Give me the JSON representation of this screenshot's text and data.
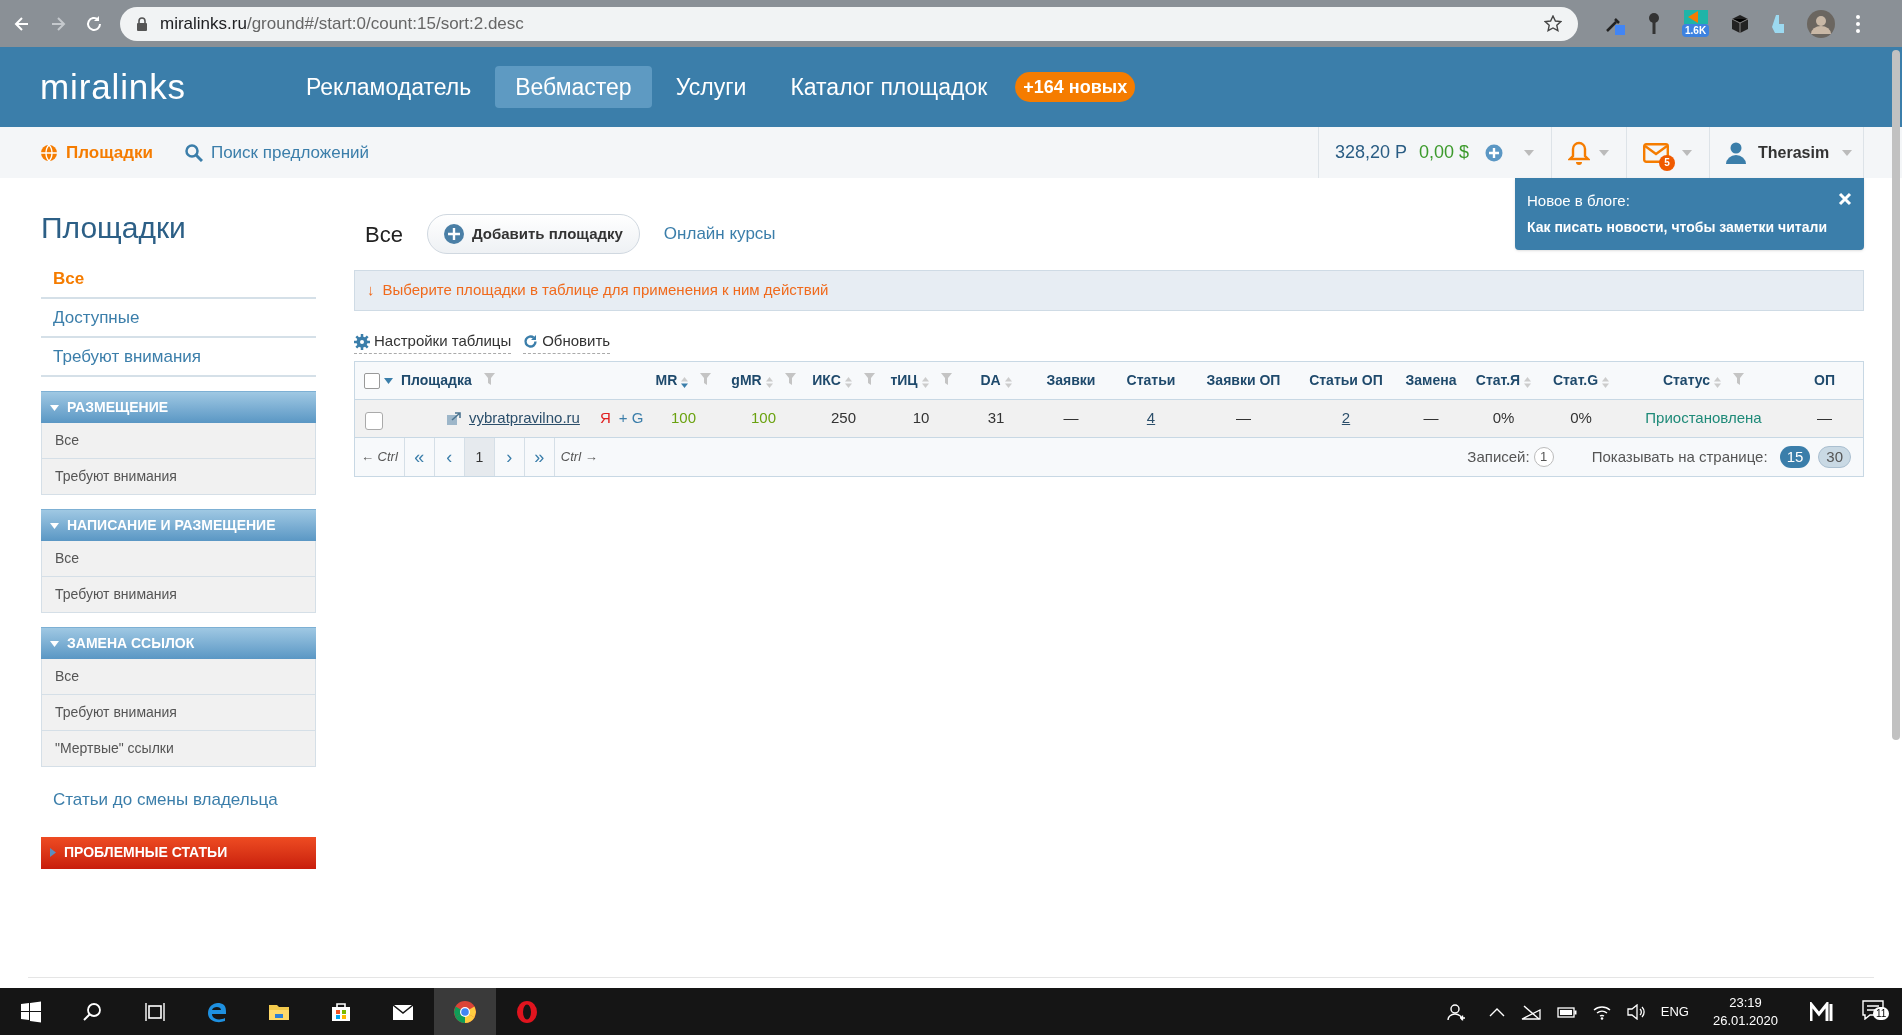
{
  "browser": {
    "url_host": "miralinks.ru",
    "url_path": "/ground#/start:0/count:15/sort:2.desc",
    "extension_badge": "1.6K"
  },
  "header": {
    "logo": "miralinks",
    "nav": [
      {
        "label": "Рекламодатель",
        "selected": false
      },
      {
        "label": "Вебмастер",
        "selected": true
      },
      {
        "label": "Услуги",
        "selected": false
      },
      {
        "label": "Каталог площадок",
        "selected": false
      }
    ],
    "catalog_badge": "+164 новых"
  },
  "subnav": {
    "items": [
      {
        "label": "Площадки",
        "selected": true,
        "kind": "globe"
      },
      {
        "label": "Поиск предложений",
        "selected": false,
        "kind": "search"
      }
    ],
    "balance_rub": "328,20 Р",
    "balance_usd": "0,00 $",
    "messages_count": "5",
    "user": "Therasim"
  },
  "blog_popup": {
    "title": "Новое в блоге:",
    "link": "Как писать новости, чтобы заметки читали"
  },
  "sidebar": {
    "title": "Площадки",
    "items": [
      {
        "label": "Все",
        "selected": true
      },
      {
        "label": "Доступные",
        "selected": false
      },
      {
        "label": "Требуют внимания",
        "selected": false
      }
    ],
    "sections": [
      {
        "title": "РАЗМЕЩЕНИЕ",
        "items": [
          "Все",
          "Требуют внимания"
        ]
      },
      {
        "title": "НАПИСАНИЕ И РАЗМЕЩЕНИЕ",
        "items": [
          "Все",
          "Требуют внимания"
        ]
      },
      {
        "title": "ЗАМЕНА ССЫЛОК",
        "items": [
          "Все",
          "Требуют внимания",
          "\"Мертвые\" ссылки"
        ]
      }
    ],
    "owner_link": "Статьи до смены владельца",
    "problem_button": "ПРОБЛЕМНЫЕ СТАТЬИ"
  },
  "main": {
    "tab": "Все",
    "add_button": "Добавить площадку",
    "courses_link": "Онлайн курсы",
    "hint": "Выберите площадки в таблице для применения к ним действий",
    "hint_arrow": "↓",
    "toolbar": [
      "Настройки таблицы",
      "Обновить"
    ],
    "table": {
      "select_all_checked": false,
      "columns": [
        {
          "label": "Площадка",
          "sortable": false,
          "filter": true
        },
        {
          "label": "MR",
          "sortable": true,
          "sorted_desc": true,
          "filter": true
        },
        {
          "label": "gMR",
          "sortable": true,
          "sorted_desc": false,
          "filter": true
        },
        {
          "label": "ИКС",
          "sortable": true,
          "sorted_desc": false,
          "filter": true
        },
        {
          "label": "тИЦ",
          "sortable": true,
          "sorted_desc": false,
          "filter": true
        },
        {
          "label": "DA",
          "sortable": true,
          "sorted_desc": false,
          "filter": false
        },
        {
          "label": "Заявки",
          "sortable": false,
          "filter": false
        },
        {
          "label": "Статьи",
          "sortable": false,
          "filter": false
        },
        {
          "label": "Заявки ОП",
          "sortable": false,
          "filter": false
        },
        {
          "label": "Статьи ОП",
          "sortable": false,
          "filter": false
        },
        {
          "label": "Замена",
          "sortable": false,
          "filter": false
        },
        {
          "label": "Стат.Я",
          "sortable": true,
          "sorted_desc": false,
          "filter": false
        },
        {
          "label": "Стат.G",
          "sortable": true,
          "sorted_desc": false,
          "filter": false
        },
        {
          "label": "Статус",
          "sortable": true,
          "sorted_desc": false,
          "filter": true
        },
        {
          "label": "ОП",
          "sortable": false,
          "filter": false
        }
      ],
      "rows": [
        {
          "checked": false,
          "cells": [
            {
              "kind": "site",
              "text": "vybratpravilno.ru",
              "yandex": "Я",
              "google": "+ G"
            },
            {
              "text": "100",
              "kind": "good"
            },
            {
              "text": "100",
              "kind": "good"
            },
            {
              "text": "250",
              "kind": "text"
            },
            {
              "text": "10",
              "kind": "text"
            },
            {
              "text": "31",
              "kind": "text"
            },
            {
              "text": "—",
              "kind": "text"
            },
            {
              "text": "4",
              "kind": "link"
            },
            {
              "text": "—",
              "kind": "text"
            },
            {
              "text": "2",
              "kind": "link"
            },
            {
              "text": "—",
              "kind": "text"
            },
            {
              "text": "0%",
              "kind": "text"
            },
            {
              "text": "0%",
              "kind": "text"
            },
            {
              "text": "Приостановлена",
              "kind": "status"
            },
            {
              "text": "—",
              "kind": "text"
            }
          ]
        }
      ]
    },
    "pager": {
      "prev_hint": "← Ctrl",
      "first": "«",
      "prev": "‹",
      "pages": [
        {
          "label": "1",
          "selected": true
        }
      ],
      "next": "›",
      "last": "»",
      "next_hint": "Ctrl →"
    },
    "records_label": "Записей:",
    "records_count": "1",
    "per_page_label": "Показывать на странице:",
    "per_page": [
      {
        "label": "15",
        "selected": true
      },
      {
        "label": "30",
        "selected": false
      }
    ]
  },
  "taskbar": {
    "lang": "ENG",
    "time": "23:19",
    "date": "26.01.2020",
    "notifications": "11"
  }
}
